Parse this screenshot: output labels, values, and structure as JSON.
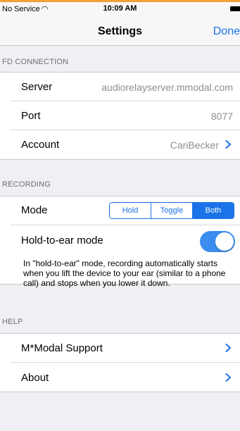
{
  "status_bar": {
    "carrier": "No Service",
    "time": "10:09 AM",
    "wifi_icon": "wifi-icon",
    "battery_icon": "battery-icon"
  },
  "navbar": {
    "title": "Settings",
    "done_label": "Done"
  },
  "sections": {
    "fd_connection": {
      "header": "FD CONNECTION",
      "server_label": "Server",
      "server_value": "audiorelayserver.mmodal.com",
      "port_label": "Port",
      "port_value": "8077",
      "account_label": "Account",
      "account_value": "CariBecker"
    },
    "recording": {
      "header": "RECORDING",
      "mode_label": "Mode",
      "mode_options": [
        "Hold",
        "Toggle",
        "Both"
      ],
      "mode_selected": "Both",
      "hold_to_ear_label": "Hold-to-ear mode",
      "hold_to_ear_on": true,
      "hold_to_ear_help": "In \"hold-to-ear\" mode, recording automatically starts when you lift the device to your ear (similar to a phone call) and stops when you lower it down."
    },
    "help": {
      "header": "HELP",
      "support_label": "M*Modal Support",
      "about_label": "About"
    }
  },
  "colors": {
    "accent": "#1a73e8",
    "toggle_on": "#3b8ef0",
    "background": "#efeff4",
    "secondary_text": "#8e8e93",
    "top_strip": "#f0a13a"
  }
}
